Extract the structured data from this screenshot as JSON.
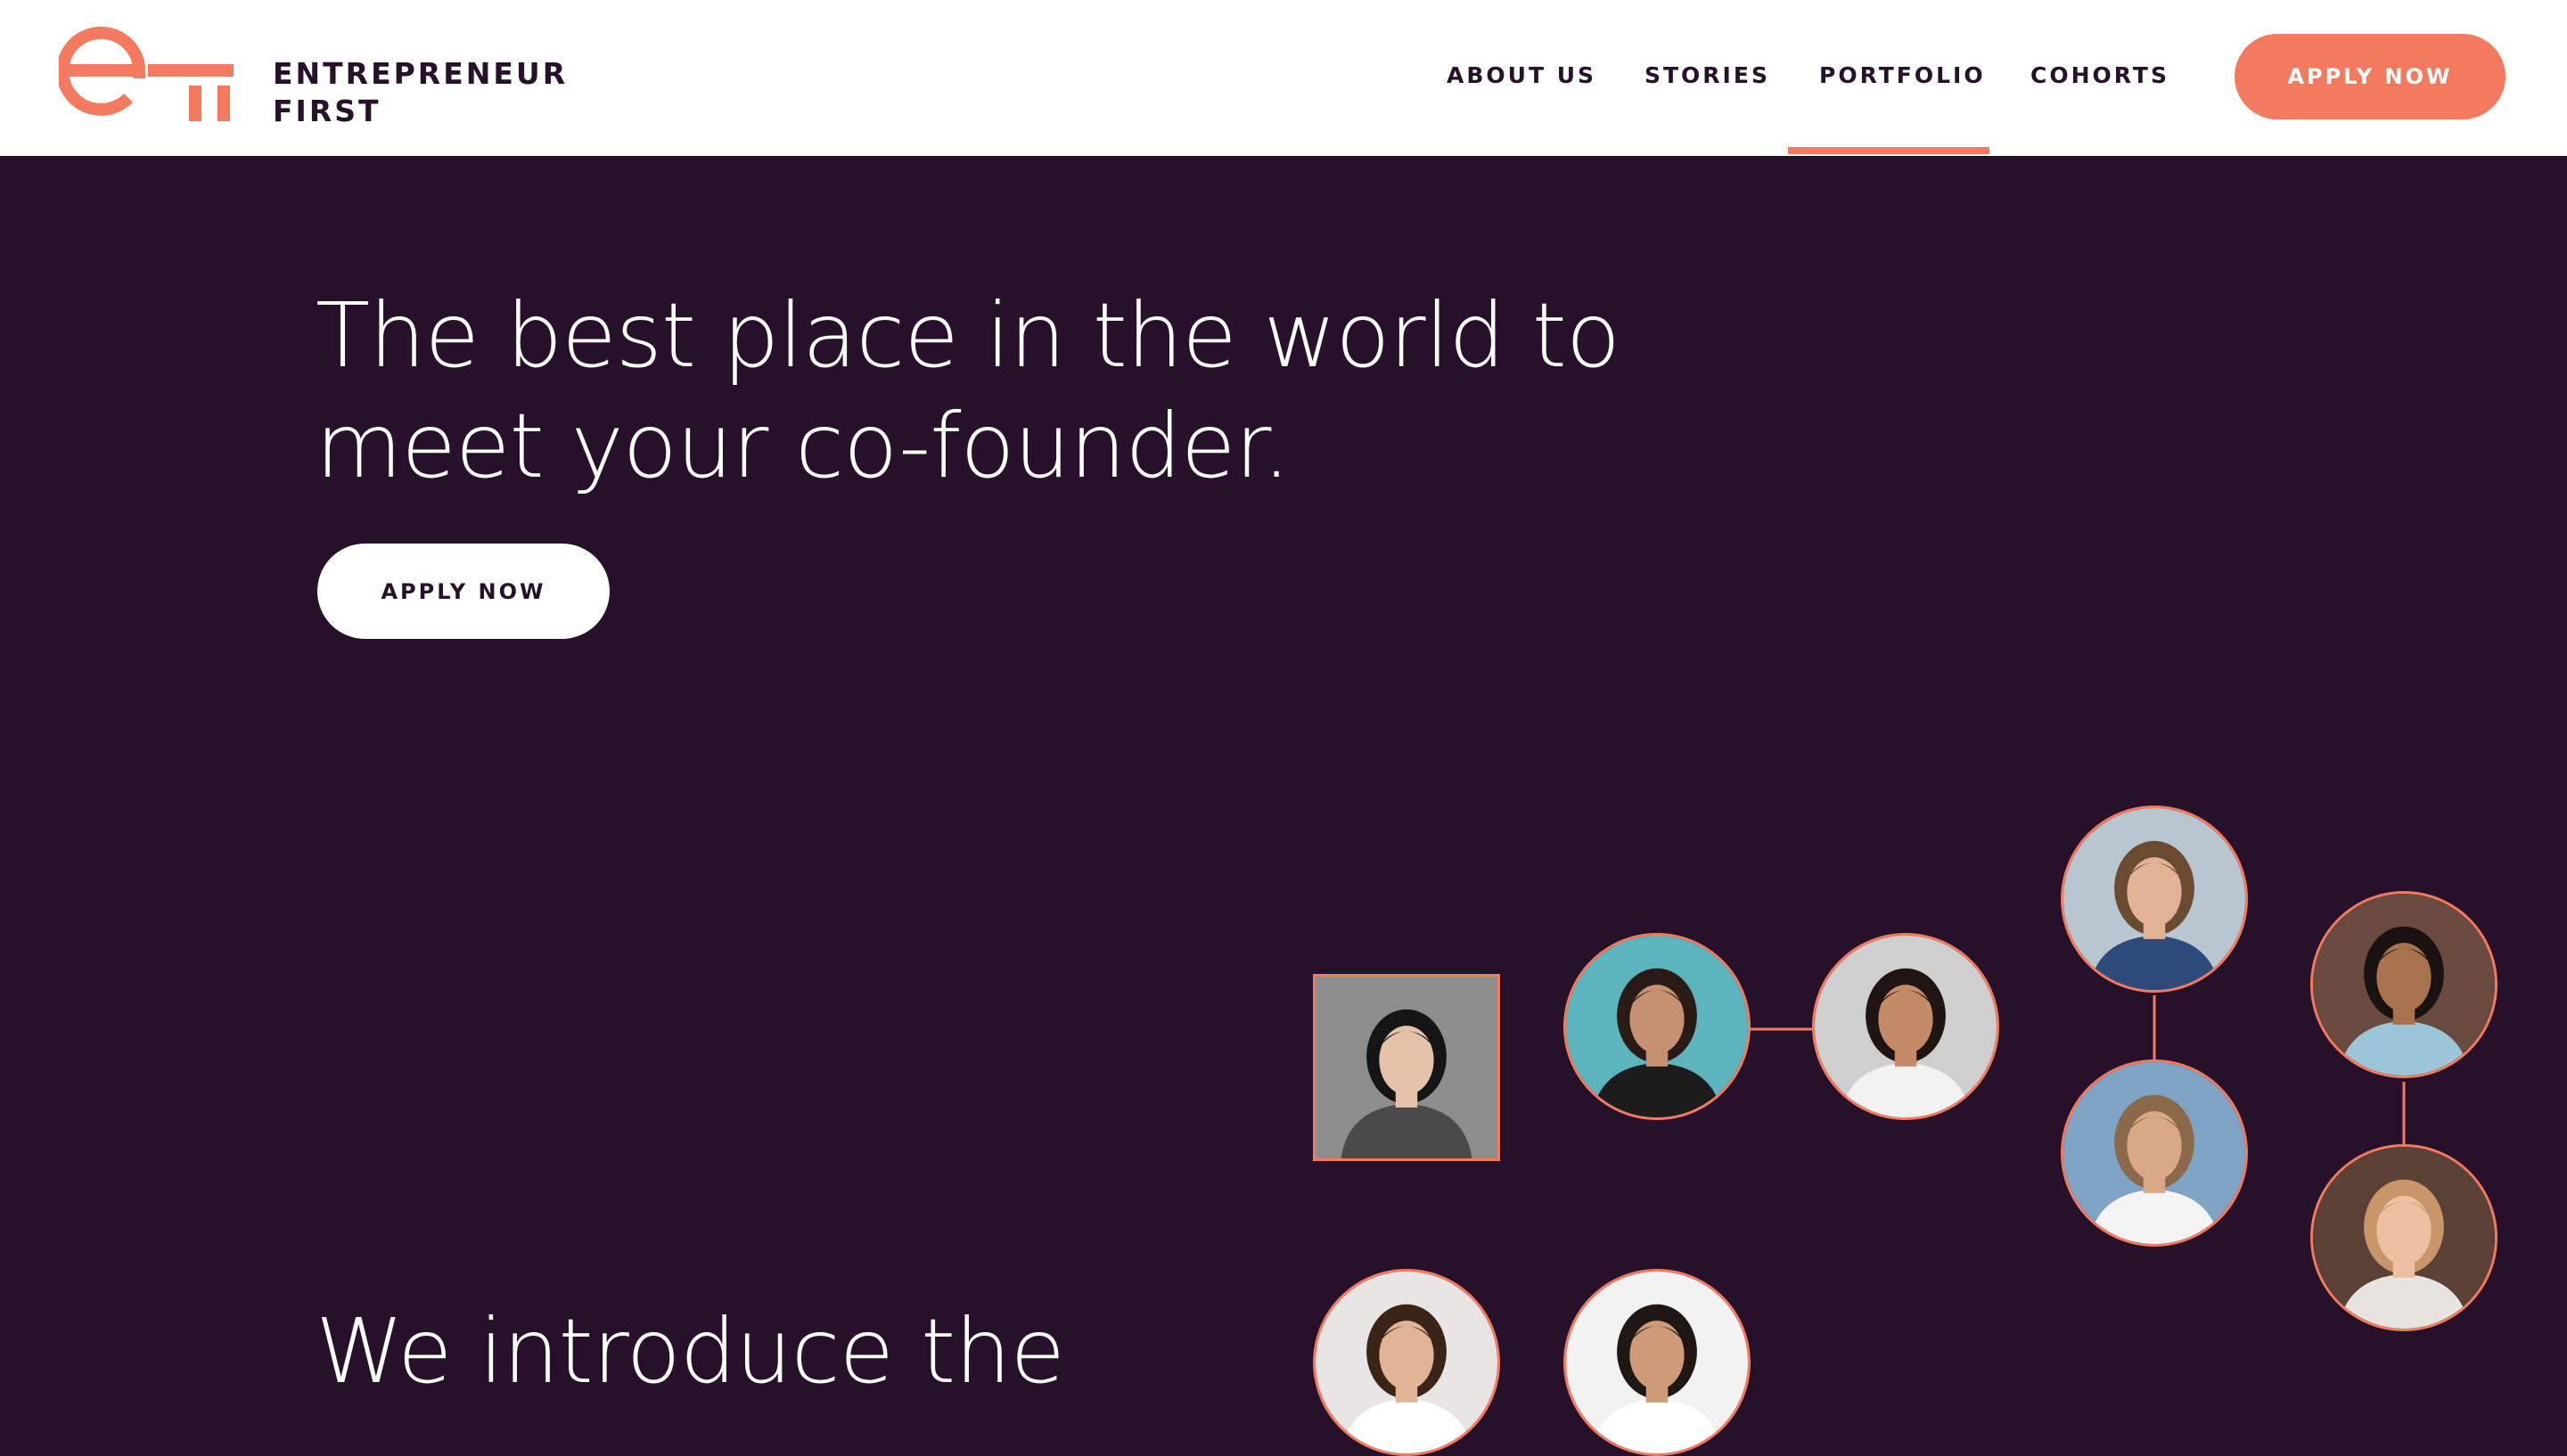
{
  "brand": {
    "name_line1": "ENTREPRENEUR",
    "name_line2": "FIRST",
    "logo_icon": "ef-logo-icon",
    "accent_color": "#f47a5f",
    "dark_color": "#26102a"
  },
  "nav": {
    "items": [
      {
        "label": "ABOUT US",
        "active": false
      },
      {
        "label": "STORIES",
        "active": false
      },
      {
        "label": "PORTFOLIO",
        "active": true
      },
      {
        "label": "COHORTS",
        "active": false
      }
    ],
    "cta_label": "APPLY NOW"
  },
  "hero": {
    "title_line1": "The best place in the world to",
    "title_line2": "meet your co-founder.",
    "cta_label": "APPLY NOW"
  },
  "intro": {
    "text": "We introduce the"
  },
  "founders": {
    "photos": [
      {
        "name": "founder-photo-1",
        "shape": "square",
        "bg": "#8d8d8d",
        "hair": "#151515",
        "skin": "#e4c3aa",
        "shirt": "#4a4a4a"
      },
      {
        "name": "founder-photo-2",
        "shape": "circle",
        "bg": "#5cb4bd",
        "hair": "#2a1a15",
        "skin": "#c69072",
        "shirt": "#1c1c1c"
      },
      {
        "name": "founder-photo-3",
        "shape": "circle",
        "bg": "#cfcfcf",
        "hair": "#1e1512",
        "skin": "#c58b68",
        "shirt": "#f2f2f2"
      },
      {
        "name": "founder-photo-4",
        "shape": "circle",
        "bg": "#b7c6cf",
        "hair": "#6b4a32",
        "skin": "#e2b294",
        "shirt": "#2e4a7a"
      },
      {
        "name": "founder-photo-5",
        "shape": "circle",
        "bg": "#7fa4c6",
        "hair": "#8a6a4a",
        "skin": "#d8a888",
        "shirt": "#f4f4f4"
      },
      {
        "name": "founder-photo-6",
        "shape": "circle",
        "bg": "#6a4a3e",
        "hair": "#1a1210",
        "skin": "#a8724e",
        "shirt": "#9cc6d8"
      },
      {
        "name": "founder-photo-7",
        "shape": "circle",
        "bg": "#5a4035",
        "hair": "#c8966a",
        "skin": "#eec0a2",
        "shirt": "#e8e4e0"
      },
      {
        "name": "founder-photo-8",
        "shape": "circle",
        "bg": "#e8e6e4",
        "hair": "#3a2418",
        "skin": "#e0b494",
        "shirt": "#ffffff"
      },
      {
        "name": "founder-photo-9",
        "shape": "circle",
        "bg": "#f2f2f2",
        "hair": "#1e1714",
        "skin": "#cf9a78",
        "shirt": "#ffffff"
      }
    ]
  }
}
